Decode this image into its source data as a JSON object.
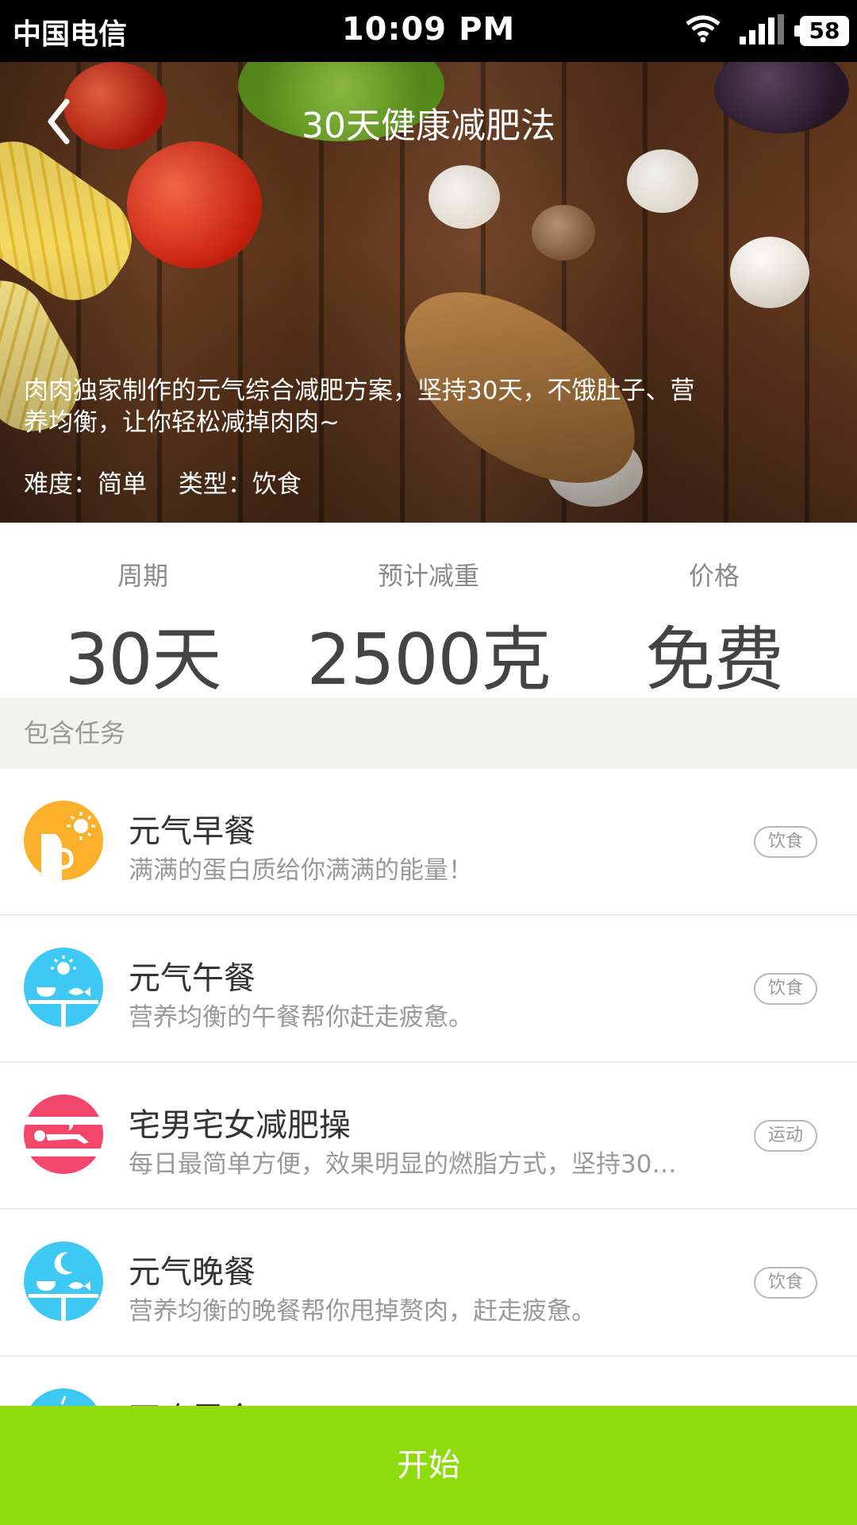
{
  "status_bar": {
    "carrier": "中国电信",
    "time": "10:09 PM",
    "battery": "58",
    "icons": [
      "wifi-icon",
      "signal-icon",
      "battery-icon"
    ]
  },
  "header": {
    "title": "30天健康减肥法",
    "back_icon": "chevron-left-icon"
  },
  "hero": {
    "description": "肉肉独家制作的元气综合减肥方案，坚持30天，不饿肚子、营养均衡，让你轻松减掉肉肉~",
    "difficulty": "难度：简单",
    "type": "类型：饮食"
  },
  "stats": [
    {
      "label": "周期",
      "value": "30天"
    },
    {
      "label": "预计减重",
      "value": "2500克"
    },
    {
      "label": "价格",
      "value": "免费"
    }
  ],
  "section": {
    "title": "包含任务"
  },
  "tasks": [
    {
      "title": "元气早餐",
      "subtitle": "满满的蛋白质给你满满的能量！",
      "tag": "饮食",
      "icon": "breakfast-icon",
      "color": "#fbb02b"
    },
    {
      "title": "元气午餐",
      "subtitle": "营养均衡的午餐帮你赶走疲惫。",
      "tag": "饮食",
      "icon": "lunch-icon",
      "color": "#3ec8f4"
    },
    {
      "title": "宅男宅女减肥操",
      "subtitle": "每日最简单方便，效果明显的燃脂方式，坚持30…",
      "tag": "运动",
      "icon": "exercise-icon",
      "color": "#f2466b"
    },
    {
      "title": "元气晚餐",
      "subtitle": "营养均衡的晚餐帮你甩掉赘肉，赶走疲惫。",
      "tag": "饮食",
      "icon": "dinner-icon",
      "color": "#3ec8f4"
    },
    {
      "title": "不吃零食",
      "subtitle": "",
      "tag": "",
      "icon": "no-snack-icon",
      "color": "#3ec8f4"
    }
  ],
  "footer": {
    "start_label": "开始",
    "accent": "#8fdc0c"
  }
}
